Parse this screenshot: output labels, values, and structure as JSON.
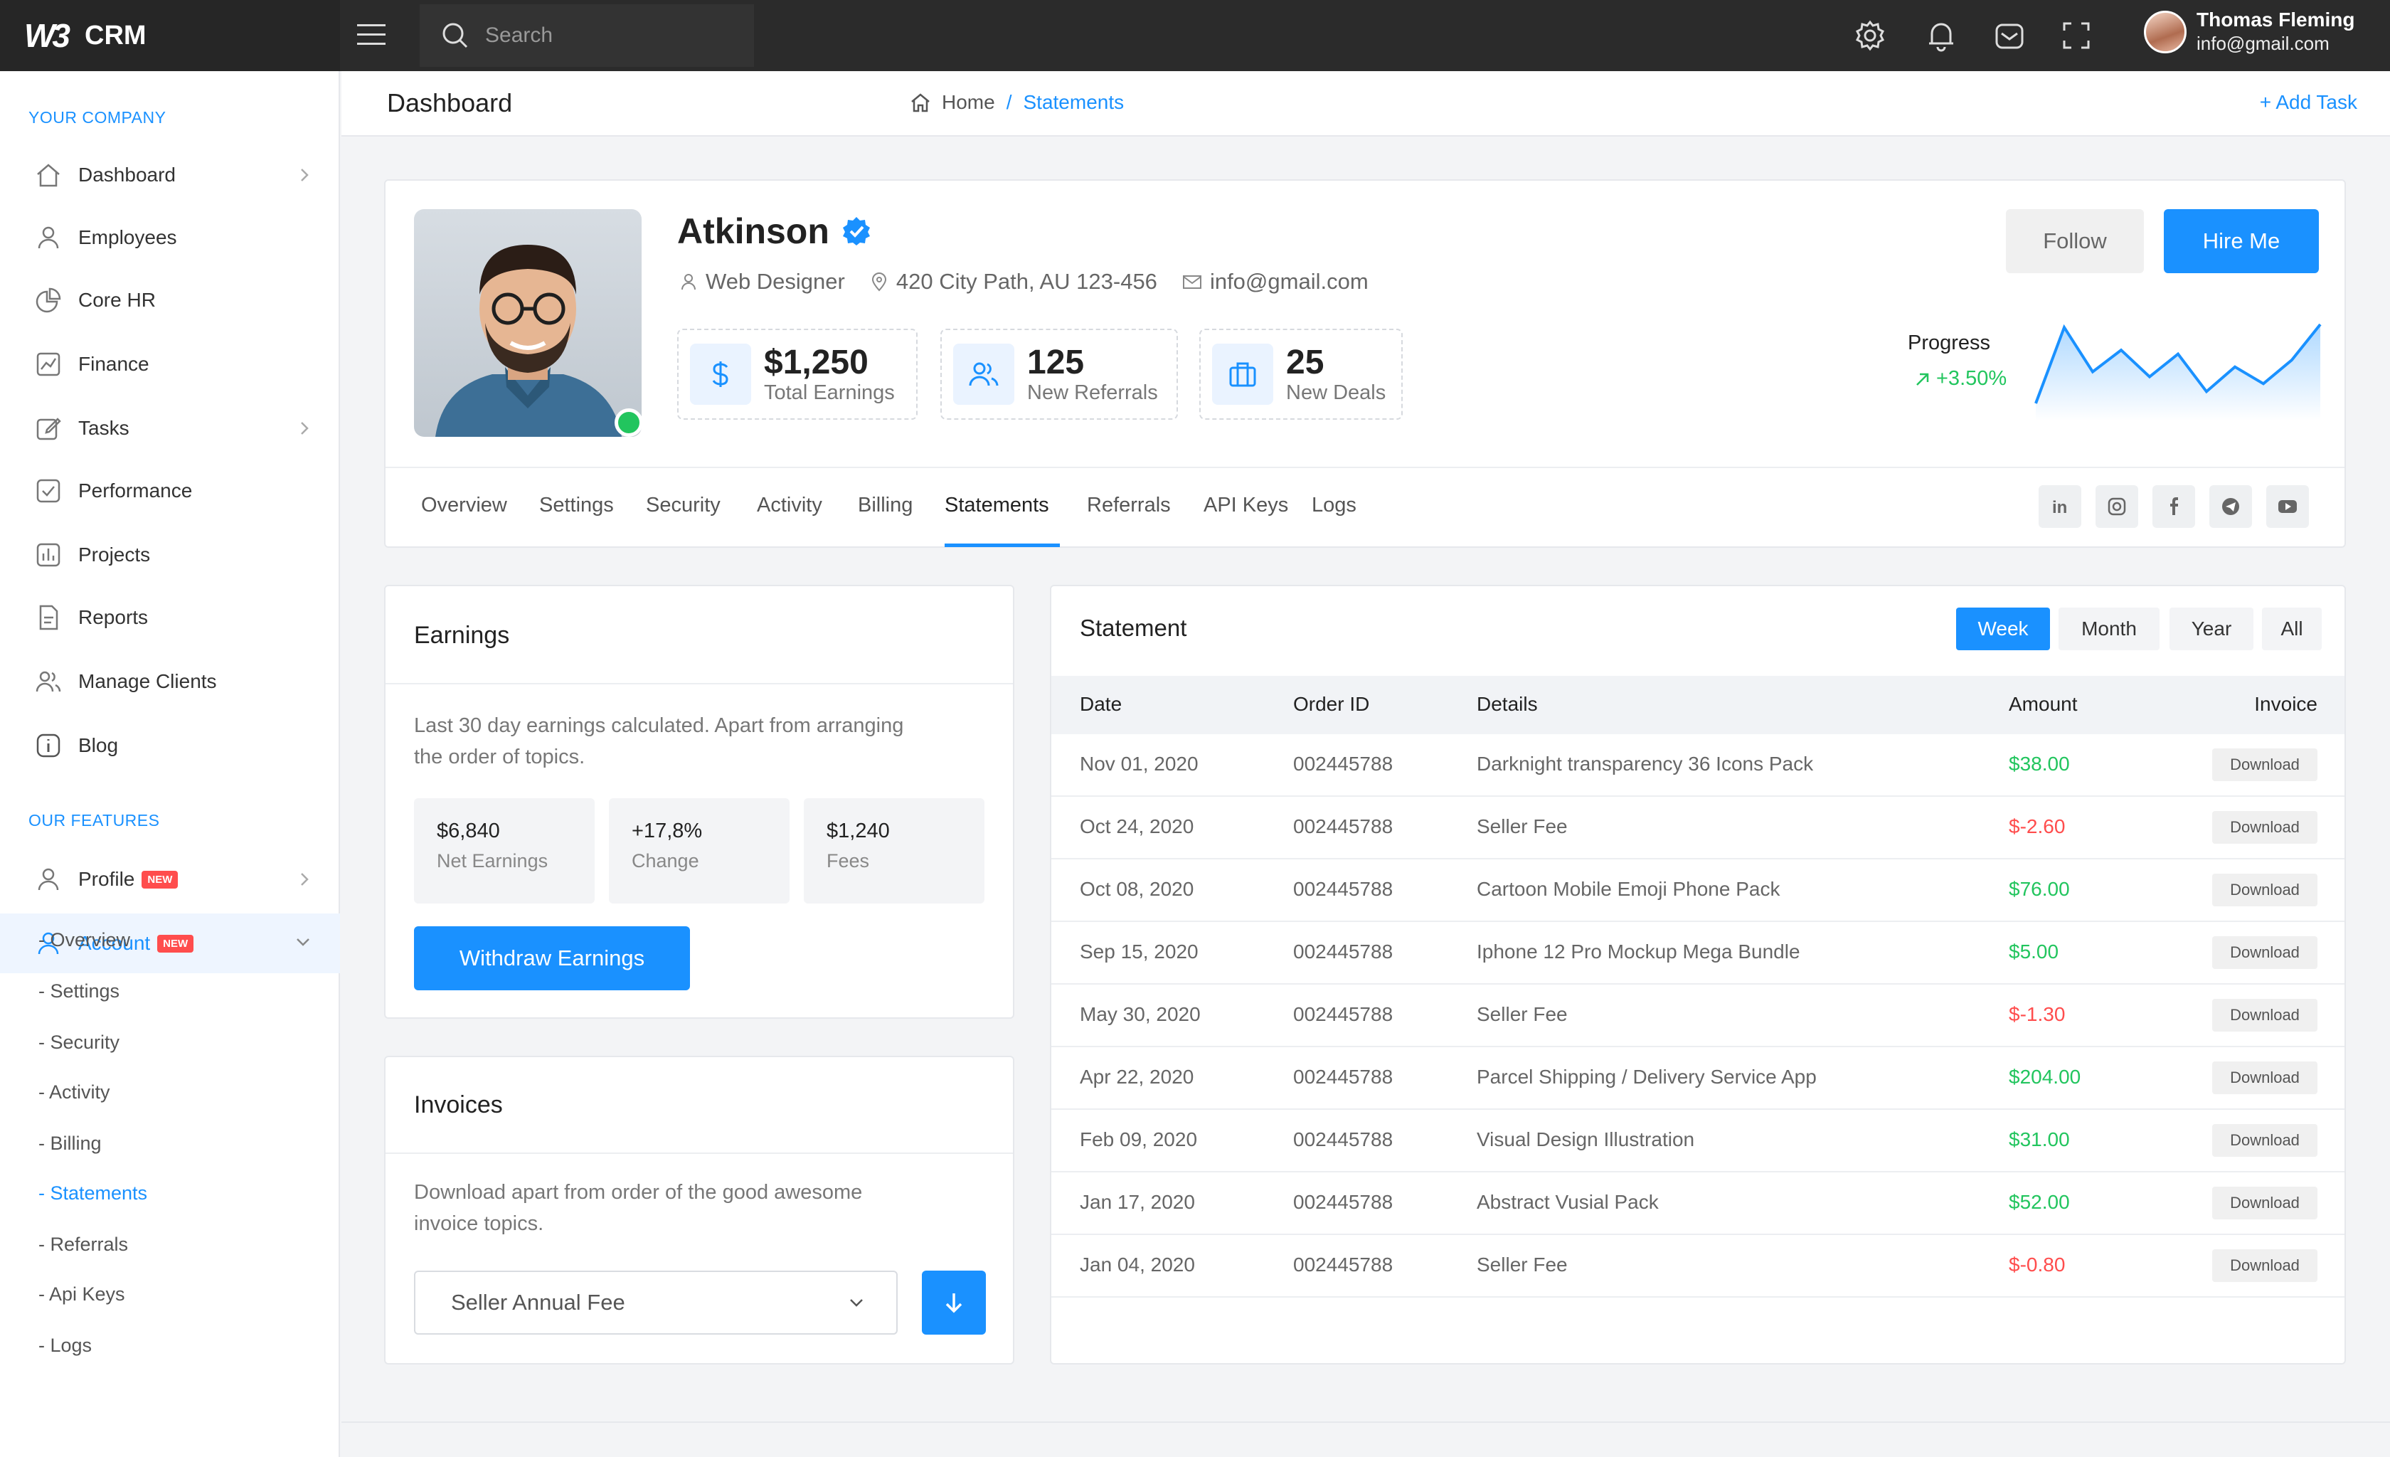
{
  "app": {
    "logo_mark": "W3",
    "logo_text": "CRM"
  },
  "search": {
    "placeholder": "Search"
  },
  "user": {
    "name": "Thomas Fleming",
    "email": "info@gmail.com"
  },
  "sidebar": {
    "section1": "YOUR COMPANY",
    "items": [
      {
        "label": "Dashboard",
        "icon": "home-icon",
        "chevron": true
      },
      {
        "label": "Employees",
        "icon": "user-icon",
        "chevron": false
      },
      {
        "label": "Core HR",
        "icon": "pie-chart-icon",
        "chevron": false
      },
      {
        "label": "Finance",
        "icon": "chart-line-icon",
        "chevron": false
      },
      {
        "label": "Tasks",
        "icon": "edit-icon",
        "chevron": true
      },
      {
        "label": "Performance",
        "icon": "check-square-icon",
        "chevron": false
      },
      {
        "label": "Projects",
        "icon": "bar-chart-icon",
        "chevron": false
      },
      {
        "label": "Reports",
        "icon": "file-icon",
        "chevron": false
      },
      {
        "label": "Manage Clients",
        "icon": "users-icon",
        "chevron": false
      },
      {
        "label": "Blog",
        "icon": "info-icon",
        "chevron": false
      }
    ],
    "section2": "OUR FEATURES",
    "profile": {
      "label": "Profile",
      "badge": "NEW"
    },
    "account": {
      "label": "Account",
      "badge": "NEW"
    },
    "subitems": [
      "- Overview",
      "- Settings",
      "- Security",
      "- Activity",
      "- Billing",
      "- Statements",
      "- Referrals",
      "- Api Keys",
      "- Logs"
    ],
    "active_sub": "- Statements"
  },
  "header": {
    "title": "Dashboard",
    "crumb_home": "Home",
    "crumb_sep": "/",
    "crumb_current": "Statements",
    "add_task": "+ Add Task"
  },
  "profile": {
    "name": "Atkinson",
    "role": "Web Designer",
    "address": "420 City Path, AU 123-456",
    "email": "info@gmail.com",
    "stats": [
      {
        "value": "$1,250",
        "label": "Total Earnings",
        "icon": "dollar-icon"
      },
      {
        "value": "125",
        "label": "New Referrals",
        "icon": "users-icon"
      },
      {
        "value": "25",
        "label": "New Deals",
        "icon": "briefcase-icon"
      }
    ],
    "follow": "Follow",
    "hire": "Hire Me",
    "progress_label": "Progress",
    "progress_value": "+3.50%",
    "sparkline": [
      18,
      95,
      50,
      72,
      45,
      68,
      30,
      55,
      38,
      62,
      98
    ],
    "tabs": [
      "Overview",
      "Settings",
      "Security",
      "Activity",
      "Billing",
      "Statements",
      "Referrals",
      "API Keys",
      "Logs"
    ],
    "active_tab": "Statements",
    "social": [
      "linkedin-icon",
      "instagram-icon",
      "facebook-icon",
      "telegram-icon",
      "youtube-icon"
    ]
  },
  "earnings": {
    "title": "Earnings",
    "description_l1": "Last 30 day earnings calculated. Apart from arranging",
    "description_l2": "the order of topics.",
    "boxes": [
      {
        "value": "$6,840",
        "label": "Net Earnings"
      },
      {
        "value": "+17,8%",
        "label": "Change"
      },
      {
        "value": "$1,240",
        "label": "Fees"
      }
    ],
    "button": "Withdraw Earnings"
  },
  "invoices": {
    "title": "Invoices",
    "description_l1": "Download apart from order of the good awesome",
    "description_l2": "invoice topics.",
    "select_value": "Seller Annual Fee"
  },
  "statement": {
    "title": "Statement",
    "periods": [
      "Week",
      "Month",
      "Year",
      "All"
    ],
    "active_period": "Week",
    "columns": [
      "Date",
      "Order ID",
      "Details",
      "Amount",
      "Invoice"
    ],
    "rows": [
      {
        "date": "Nov 01, 2020",
        "order": "002445788",
        "details": "Darknight transparency 36 Icons Pack",
        "amount": "$38.00",
        "sign": "pos",
        "invoice": "Download"
      },
      {
        "date": "Oct 24, 2020",
        "order": "002445788",
        "details": "Seller Fee",
        "amount": "$-2.60",
        "sign": "neg",
        "invoice": "Download"
      },
      {
        "date": "Oct 08, 2020",
        "order": "002445788",
        "details": "Cartoon Mobile Emoji Phone Pack",
        "amount": "$76.00",
        "sign": "pos",
        "invoice": "Download"
      },
      {
        "date": "Sep 15, 2020",
        "order": "002445788",
        "details": "Iphone 12 Pro Mockup Mega Bundle",
        "amount": "$5.00",
        "sign": "pos",
        "invoice": "Download"
      },
      {
        "date": "May 30, 2020",
        "order": "002445788",
        "details": "Seller Fee",
        "amount": "$-1.30",
        "sign": "neg",
        "invoice": "Download"
      },
      {
        "date": "Apr 22, 2020",
        "order": "002445788",
        "details": "Parcel Shipping / Delivery Service App",
        "amount": "$204.00",
        "sign": "pos",
        "invoice": "Download"
      },
      {
        "date": "Feb 09, 2020",
        "order": "002445788",
        "details": "Visual Design Illustration",
        "amount": "$31.00",
        "sign": "pos",
        "invoice": "Download"
      },
      {
        "date": "Jan 17, 2020",
        "order": "002445788",
        "details": "Abstract Vusial Pack",
        "amount": "$52.00",
        "sign": "pos",
        "invoice": "Download"
      },
      {
        "date": "Jan 04, 2020",
        "order": "002445788",
        "details": "Seller Fee",
        "amount": "$-0.80",
        "sign": "neg",
        "invoice": "Download"
      }
    ]
  },
  "colors": {
    "accent": "#1a91ff",
    "positive": "#22c55e",
    "negative": "#ff4d4d",
    "topbar": "#2b2b2b"
  }
}
